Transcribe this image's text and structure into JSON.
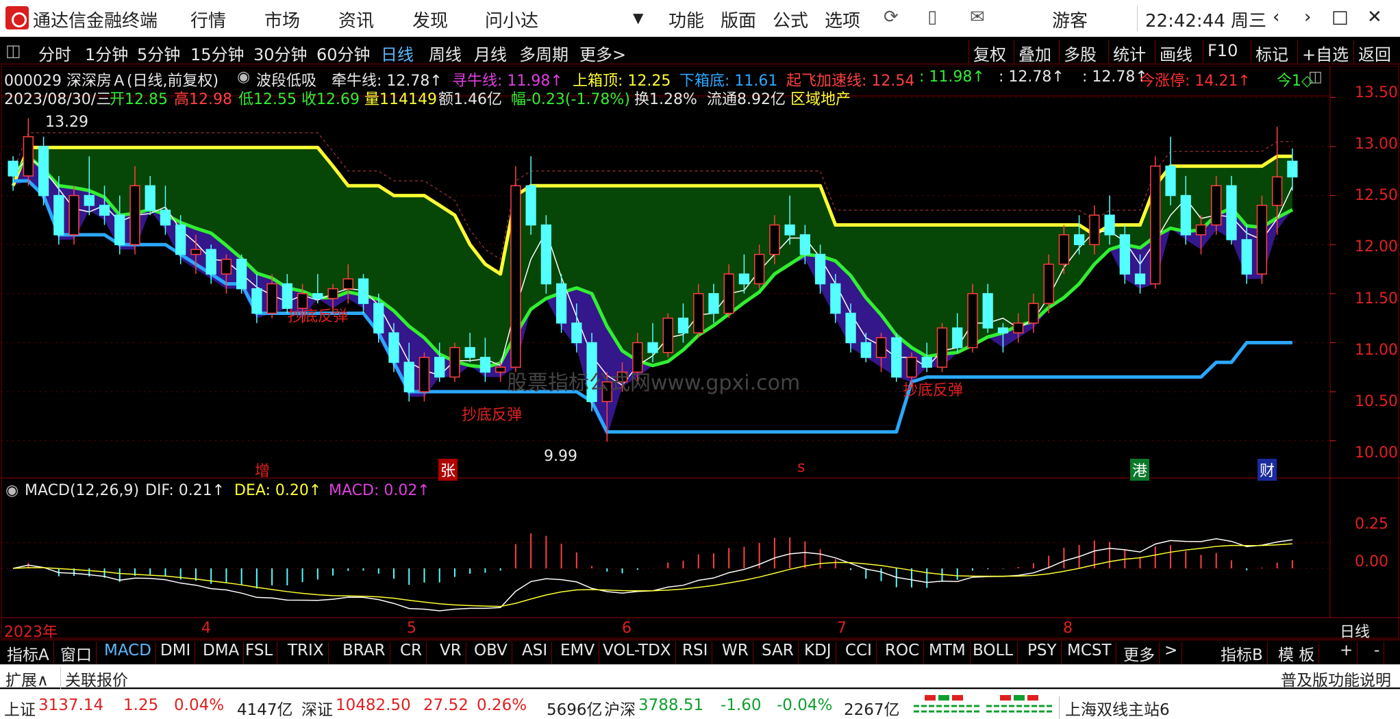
{
  "window": {
    "app_title": "通达信金融终端",
    "user": "游客",
    "clock": "22:42:44 周三"
  },
  "menu": [
    "行情",
    "市场",
    "资讯",
    "发现",
    "问小达"
  ],
  "right_menu": [
    "功能",
    "版面",
    "公式",
    "选项"
  ],
  "periods": [
    "分时",
    "1分钟",
    "5分钟",
    "15分钟",
    "30分钟",
    "60分钟",
    "日线",
    "周线",
    "月线",
    "多周期",
    "更多>"
  ],
  "active_period": "日线",
  "right_tools": [
    "复权",
    "叠加",
    "多股",
    "统计",
    "画线",
    "F10",
    "标记",
    "+自选",
    "返回"
  ],
  "info1": {
    "code_name": "000029 深深房Ａ(日线,前复权)",
    "indicator": "波段低吸",
    "qianniu": "牵牛线: 12.78↑",
    "xunniu": "寻牛线: 11.98↑",
    "shang": "上箱顶: 12.25",
    "xia": "下箱底: 11.61",
    "qifei": "起飞加速线: 12.54",
    "qifei2": ": 11.98↑",
    "v1": ": 12.78↑",
    "v2": ": 12.78↑",
    "zhangting": "今涨停: 14.21↑",
    "jin": "今1◇"
  },
  "info2": {
    "date": "2023/08/30/三",
    "open": "开12.85",
    "high": "高12.98",
    "low": "低12.55",
    "close": "收12.69",
    "vol": "量114149",
    "amt": "额1.46亿",
    "chg": "幅-0.23(-1.78%)",
    "turn": "换1.28%",
    "float": "流通8.92亿",
    "sector": "区域地产"
  },
  "price_axis": [
    "13.50",
    "13.00",
    "12.50",
    "12.00",
    "11.50",
    "11.00",
    "10.50",
    "10.00"
  ],
  "high_mark": "13.29",
  "low_mark": "9.99",
  "signal_labels": [
    "抄底反弹",
    "抄底反弹",
    "抄底反弹"
  ],
  "event_markers": [
    "增",
    "张",
    "s",
    "港",
    "财"
  ],
  "watermark": "股票指标公式网www.gpxi.com",
  "macd_header": {
    "name": "MACD(12,26,9)",
    "dif": "DIF: 0.21↑",
    "dea": "DEA: 0.20↑",
    "macd": "MACD: 0.02↑"
  },
  "macd_axis": [
    "0.25",
    "0.00"
  ],
  "time_axis": [
    "2023年",
    "4",
    "5",
    "6",
    "7",
    "8"
  ],
  "time_axis_right": "日线",
  "indicator_tabs": [
    "指标A",
    "窗口",
    "MACD",
    "DMI",
    "DMA",
    "FSL",
    "TRIX",
    "BRAR",
    "CR",
    "VR",
    "OBV",
    "ASI",
    "EMV",
    "VOL-TDX",
    "RSI",
    "WR",
    "SAR",
    "KDJ",
    "CCI",
    "ROC",
    "MTM",
    "BOLL",
    "PSY",
    "MCST",
    "更多",
    ">"
  ],
  "active_tab": "MACD",
  "tabs_right": [
    "指标B",
    "模 板",
    "+",
    "-"
  ],
  "ext": {
    "left": "扩展∧",
    "quote": "关联报价",
    "right": "普及版功能说明"
  },
  "status": {
    "sh": {
      "name": "上证",
      "val": "3137.14",
      "chg": "1.25",
      "pct": "0.04%",
      "amt": "4147亿"
    },
    "sz": {
      "name": "深证",
      "val": "10482.50",
      "chg": "27.52",
      "pct": "0.26%",
      "amt": "5696亿"
    },
    "hs": {
      "name": "沪深",
      "val": "3788.51",
      "chg": "-1.60",
      "pct": "-0.04%",
      "amt": "2267亿"
    },
    "server": "上海双线主站6"
  },
  "colors": {
    "bull": "#ff4040",
    "bear": "#54ffff",
    "yellow": "#ffff33",
    "green_line": "#33ee33",
    "blue_line": "#2ba8ff",
    "fill_green": "#064a06",
    "fill_purple": "#3a1a9a",
    "fill_red": "#5a0f0f"
  },
  "chart_data": {
    "type": "candlestick",
    "ylim": [
      9.9,
      13.6
    ],
    "candles": [
      [
        12.85,
        12.9,
        12.55,
        12.7
      ],
      [
        12.7,
        13.29,
        12.6,
        13.1
      ],
      [
        13.0,
        13.1,
        12.4,
        12.5
      ],
      [
        12.5,
        12.7,
        12.0,
        12.1
      ],
      [
        12.1,
        12.6,
        12.0,
        12.5
      ],
      [
        12.5,
        12.9,
        12.3,
        12.4
      ],
      [
        12.4,
        12.6,
        12.2,
        12.3
      ],
      [
        12.3,
        12.5,
        11.9,
        12.0
      ],
      [
        12.0,
        12.8,
        11.9,
        12.6
      ],
      [
        12.6,
        12.7,
        12.3,
        12.35
      ],
      [
        12.35,
        12.6,
        12.1,
        12.2
      ],
      [
        12.2,
        12.3,
        11.8,
        11.9
      ],
      [
        11.9,
        12.1,
        11.7,
        11.95
      ],
      [
        11.95,
        12.0,
        11.6,
        11.7
      ],
      [
        11.7,
        11.9,
        11.5,
        11.85
      ],
      [
        11.85,
        11.9,
        11.5,
        11.55
      ],
      [
        11.55,
        11.7,
        11.2,
        11.3
      ],
      [
        11.3,
        11.7,
        11.25,
        11.6
      ],
      [
        11.6,
        11.7,
        11.3,
        11.35
      ],
      [
        11.35,
        11.6,
        11.2,
        11.5
      ],
      [
        11.5,
        11.7,
        11.4,
        11.45
      ],
      [
        11.45,
        11.6,
        11.3,
        11.55
      ],
      [
        11.55,
        11.8,
        11.4,
        11.65
      ],
      [
        11.65,
        11.7,
        11.3,
        11.4
      ],
      [
        11.4,
        11.5,
        11.0,
        11.1
      ],
      [
        11.1,
        11.2,
        10.7,
        10.8
      ],
      [
        10.8,
        11.0,
        10.4,
        10.5
      ],
      [
        10.5,
        10.9,
        10.4,
        10.85
      ],
      [
        10.85,
        11.0,
        10.6,
        10.65
      ],
      [
        10.65,
        11.0,
        10.6,
        10.95
      ],
      [
        10.95,
        11.1,
        10.8,
        10.85
      ],
      [
        10.85,
        11.05,
        10.6,
        10.7
      ],
      [
        10.7,
        10.8,
        10.6,
        10.75
      ],
      [
        10.75,
        12.8,
        10.7,
        12.6
      ],
      [
        12.6,
        12.9,
        12.1,
        12.2
      ],
      [
        12.2,
        12.3,
        11.5,
        11.6
      ],
      [
        11.6,
        11.7,
        11.1,
        11.2
      ],
      [
        11.2,
        11.4,
        10.9,
        11.0
      ],
      [
        11.0,
        11.1,
        10.3,
        10.4
      ],
      [
        10.4,
        10.7,
        9.99,
        10.6
      ],
      [
        10.6,
        10.8,
        10.5,
        10.7
      ],
      [
        10.7,
        11.1,
        10.6,
        11.0
      ],
      [
        11.0,
        11.2,
        10.8,
        10.9
      ],
      [
        10.9,
        11.3,
        10.85,
        11.25
      ],
      [
        11.25,
        11.4,
        11.0,
        11.1
      ],
      [
        11.1,
        11.6,
        11.05,
        11.5
      ],
      [
        11.5,
        11.6,
        11.2,
        11.3
      ],
      [
        11.3,
        11.8,
        11.25,
        11.7
      ],
      [
        11.7,
        11.9,
        11.5,
        11.6
      ],
      [
        11.6,
        12.0,
        11.55,
        11.9
      ],
      [
        11.9,
        12.3,
        11.8,
        12.2
      ],
      [
        12.2,
        12.5,
        12.0,
        12.1
      ],
      [
        12.1,
        12.2,
        11.8,
        11.9
      ],
      [
        11.9,
        12.0,
        11.5,
        11.6
      ],
      [
        11.6,
        11.7,
        11.2,
        11.3
      ],
      [
        11.3,
        11.4,
        10.9,
        11.0
      ],
      [
        11.0,
        11.1,
        10.8,
        10.85
      ],
      [
        10.85,
        11.1,
        10.7,
        11.05
      ],
      [
        11.05,
        11.1,
        10.6,
        10.65
      ],
      [
        10.65,
        10.9,
        10.55,
        10.85
      ],
      [
        10.85,
        11.0,
        10.7,
        10.75
      ],
      [
        10.75,
        11.2,
        10.7,
        11.15
      ],
      [
        11.15,
        11.3,
        10.9,
        10.95
      ],
      [
        10.95,
        11.6,
        10.9,
        11.5
      ],
      [
        11.5,
        11.6,
        11.1,
        11.15
      ],
      [
        11.15,
        11.2,
        10.9,
        11.1
      ],
      [
        11.1,
        11.3,
        11.0,
        11.2
      ],
      [
        11.2,
        11.5,
        11.1,
        11.4
      ],
      [
        11.4,
        11.9,
        11.3,
        11.8
      ],
      [
        11.8,
        12.2,
        11.7,
        12.1
      ],
      [
        12.1,
        12.3,
        11.9,
        12.0
      ],
      [
        12.0,
        12.4,
        11.9,
        12.3
      ],
      [
        12.3,
        12.5,
        12.0,
        12.1
      ],
      [
        12.1,
        12.2,
        11.6,
        11.7
      ],
      [
        11.7,
        11.9,
        11.5,
        11.6
      ],
      [
        11.6,
        12.9,
        11.55,
        12.8
      ],
      [
        12.8,
        13.1,
        12.4,
        12.5
      ],
      [
        12.5,
        12.7,
        12.0,
        12.1
      ],
      [
        12.1,
        12.3,
        11.9,
        12.2
      ],
      [
        12.2,
        12.7,
        12.1,
        12.6
      ],
      [
        12.6,
        12.7,
        12.0,
        12.05
      ],
      [
        12.05,
        12.2,
        11.6,
        11.7
      ],
      [
        11.7,
        12.5,
        11.6,
        12.4
      ],
      [
        12.4,
        13.2,
        12.1,
        12.69
      ],
      [
        12.85,
        12.98,
        12.55,
        12.69
      ]
    ]
  }
}
